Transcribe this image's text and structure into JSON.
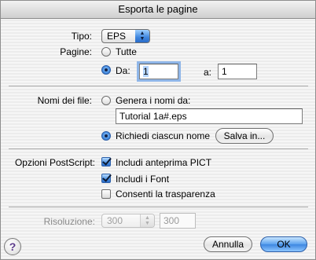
{
  "window": {
    "title": "Esporta le pagine"
  },
  "format": {
    "label": "Tipo:",
    "value": "EPS"
  },
  "pages": {
    "label": "Pagine:",
    "all_label": "Tutte",
    "from_label": "Da:",
    "from_value": "1",
    "to_label": "a:",
    "to_value": "1",
    "selected": "from"
  },
  "file_names": {
    "label": "Nomi dei file:",
    "generate_label": "Genera i nomi da:",
    "name_value": "Tutorial 1a#.eps",
    "ask_label": "Richiedi ciascun nome",
    "save_button": "Salva in...",
    "selected": "ask"
  },
  "postscript": {
    "label": "Opzioni PostScript:",
    "options": [
      {
        "label": "Includi anteprima PICT",
        "checked": true
      },
      {
        "label": "Includi i Font",
        "checked": true
      },
      {
        "label": "Consenti la trasparenza",
        "checked": false
      }
    ]
  },
  "resolution": {
    "label": "Risoluzione:",
    "popup_value": "300",
    "field_value": "300"
  },
  "footer": {
    "help": "?",
    "cancel": "Annulla",
    "ok": "OK"
  }
}
